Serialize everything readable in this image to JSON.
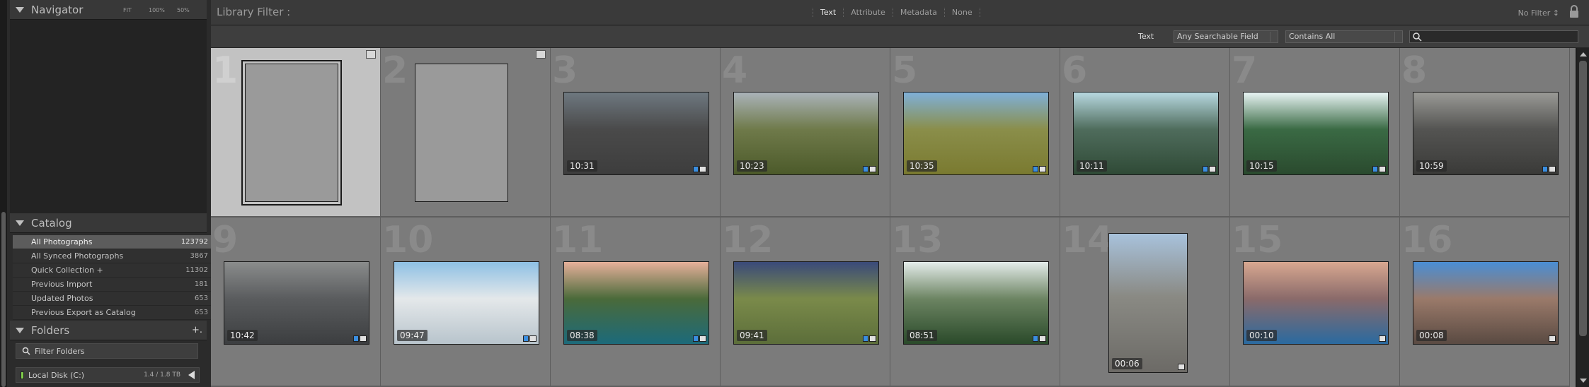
{
  "left": {
    "navigator": {
      "title": "Navigator",
      "zoom": [
        "FIT",
        "100%",
        "50%"
      ]
    },
    "catalog": {
      "title": "Catalog",
      "items": [
        {
          "label": "All Photographs",
          "count": "123792",
          "selected": true
        },
        {
          "label": "All Synced Photographs",
          "count": "3867"
        },
        {
          "label": "Quick Collection +",
          "count": "11302"
        },
        {
          "label": "Previous Import",
          "count": "181"
        },
        {
          "label": "Updated Photos",
          "count": "653"
        },
        {
          "label": "Previous Export as Catalog",
          "count": "653"
        }
      ]
    },
    "folders": {
      "title": "Folders",
      "add_label": "+.",
      "filter_label": "Filter Folders",
      "disk_label": "Local Disk (C:)",
      "disk_size": "1.4 / 1.8 TB"
    }
  },
  "filter_bar": {
    "title": "Library Filter :",
    "tabs": [
      "Text",
      "Attribute",
      "Metadata",
      "None"
    ],
    "no_filter": "No Filter ↕",
    "text_label": "Text",
    "field_select": "Any Searchable Field",
    "rule_select": "Contains All",
    "search_value": ""
  },
  "grid": {
    "cells": [
      {
        "num": "1",
        "type": "blank",
        "selected": true
      },
      {
        "num": "2",
        "type": "blank"
      },
      {
        "num": "3",
        "dur": "10:31",
        "colors": [
          "#6e7880",
          "#4a4a4a",
          "#3d3d3d"
        ]
      },
      {
        "num": "4",
        "dur": "10:23",
        "colors": [
          "#aab3b9",
          "#6f7a4a",
          "#4c5a2a"
        ]
      },
      {
        "num": "5",
        "dur": "10:35",
        "colors": [
          "#7fb0d8",
          "#8a8e4a",
          "#7a7a30"
        ]
      },
      {
        "num": "6",
        "dur": "10:11",
        "colors": [
          "#b7d8e0",
          "#4f6c5c",
          "#2f4a36"
        ]
      },
      {
        "num": "7",
        "dur": "10:15",
        "colors": [
          "#e8f4f4",
          "#3a6a44",
          "#2a4a2e"
        ]
      },
      {
        "num": "8",
        "dur": "10:59",
        "colors": [
          "#9a9a96",
          "#545452",
          "#3a3a38"
        ]
      },
      {
        "num": "9",
        "dur": "10:42",
        "colors": [
          "#8a8c8c",
          "#5a5c5e",
          "#3c3e40"
        ]
      },
      {
        "num": "10",
        "dur": "09:47",
        "colors": [
          "#8ec0e4",
          "#e4e8ea",
          "#b8c4cc"
        ]
      },
      {
        "num": "11",
        "dur": "08:38",
        "colors": [
          "#e6b09a",
          "#4a6a3a",
          "#1c6a7a"
        ]
      },
      {
        "num": "12",
        "dur": "09:41",
        "colors": [
          "#3a4a7a",
          "#7a8a4a",
          "#5c6e3a"
        ]
      },
      {
        "num": "13",
        "dur": "08:51",
        "colors": [
          "#e4ecea",
          "#6c8462",
          "#2a4a2a"
        ]
      },
      {
        "num": "14",
        "dur": "00:06",
        "colors": [
          "#a8c2dc",
          "#8a8a84",
          "#6c6a66"
        ],
        "portrait": true
      },
      {
        "num": "15",
        "dur": "00:10",
        "colors": [
          "#d8a890",
          "#8a6a6a",
          "#2a6aa0"
        ]
      },
      {
        "num": "16",
        "dur": "00:08",
        "colors": [
          "#4a8ed4",
          "#9a7a6a",
          "#5a4a42"
        ]
      }
    ]
  }
}
